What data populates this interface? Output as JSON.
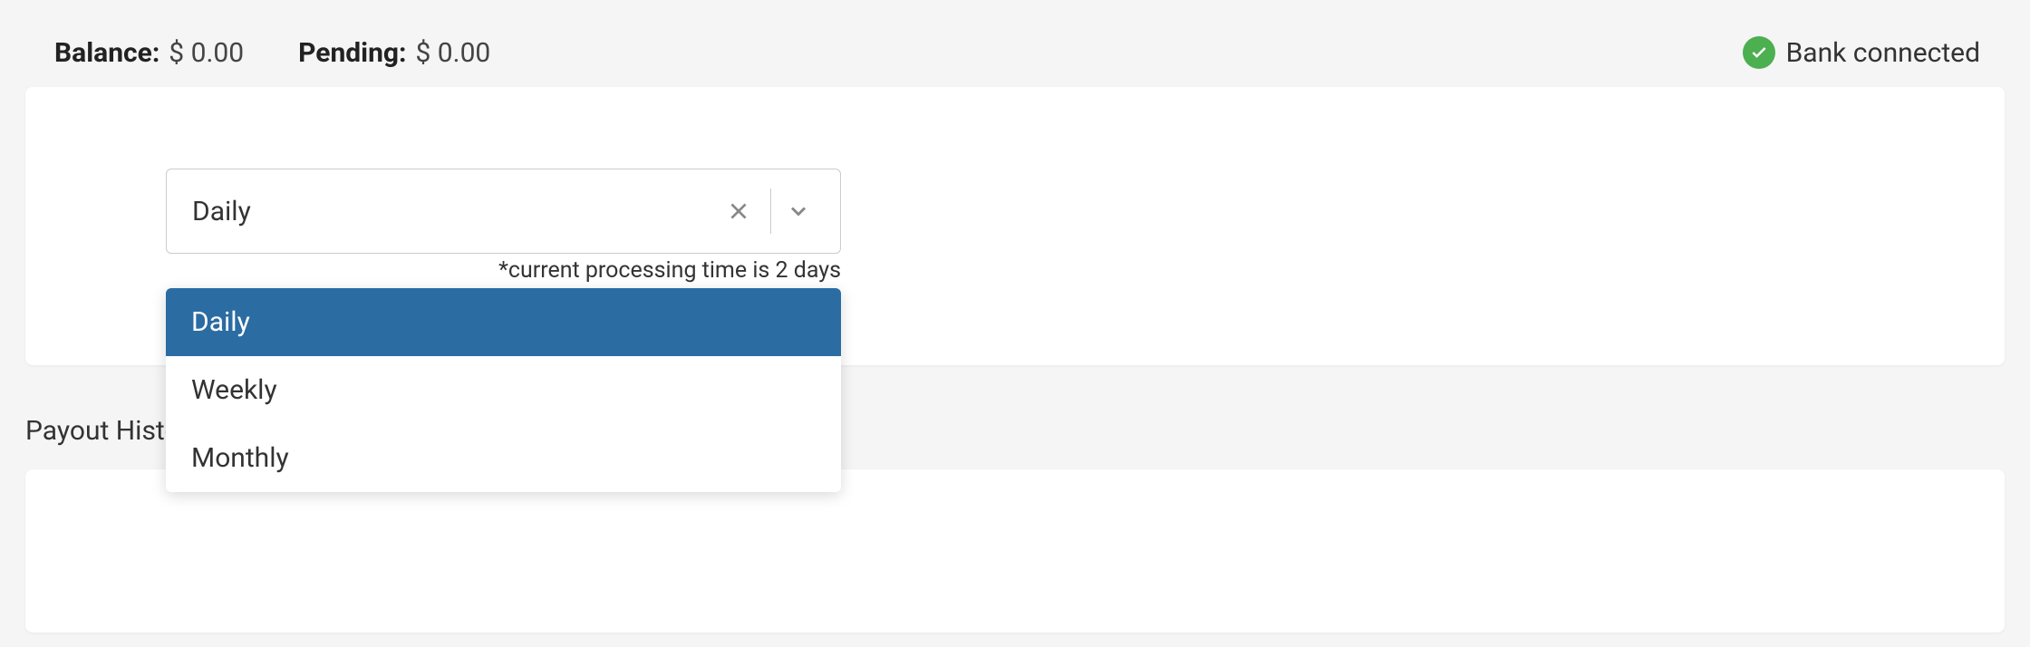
{
  "header": {
    "balance_label": "Balance:",
    "balance_value": "$ 0.00",
    "pending_label": "Pending:",
    "pending_value": "$ 0.00",
    "bank_status": "Bank connected"
  },
  "select": {
    "value": "Daily",
    "helper": "*current processing time is 2 days",
    "options": [
      "Daily",
      "Weekly",
      "Monthly"
    ]
  },
  "section": {
    "payout_history": "Payout History"
  }
}
